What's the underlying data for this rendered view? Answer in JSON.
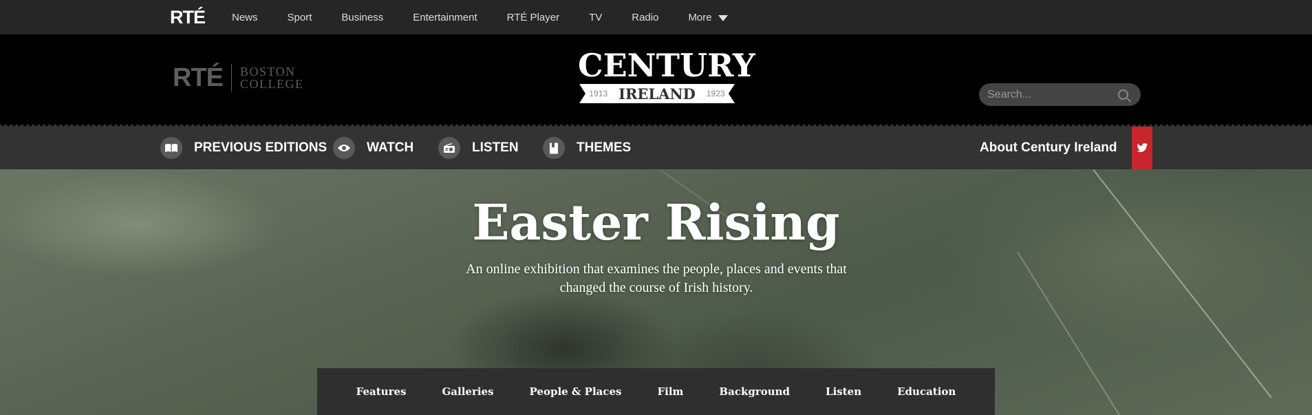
{
  "rte_nav": {
    "logo": "RTÉ",
    "links": [
      "News",
      "Sport",
      "Business",
      "Entertainment",
      "RTÉ Player",
      "TV",
      "Radio"
    ],
    "more_label": "More"
  },
  "header": {
    "partner_rte": "RTÉ",
    "partner_bc_line1": "BOSTON",
    "partner_bc_line2": "COLLEGE",
    "brand_title": "CENTURY",
    "brand_year_start": "1913",
    "brand_ireland": "IRELAND",
    "brand_year_end": "1923",
    "search_placeholder": "Search..."
  },
  "subnav": {
    "items": [
      {
        "label": "PREVIOUS EDITIONS",
        "icon": "book-icon"
      },
      {
        "label": "WATCH",
        "icon": "eye-icon"
      },
      {
        "label": "LISTEN",
        "icon": "radio-icon"
      },
      {
        "label": "THEMES",
        "icon": "bookmark-icon"
      }
    ],
    "about_label": "About Century Ireland",
    "twitter_icon": "twitter-icon"
  },
  "hero": {
    "title": "Easter Rising",
    "subtitle_line1": "An online exhibition that examines the people, places and events that",
    "subtitle_line2": "changed the course of Irish history."
  },
  "section_tabs": [
    "Features",
    "Galleries",
    "People & Places",
    "Film",
    "Background",
    "Listen",
    "Education"
  ],
  "colors": {
    "twitter_flag": "#c9252c",
    "nav_bg": "#262626",
    "header_bg": "#000000",
    "subnav_bg": "#333333"
  }
}
